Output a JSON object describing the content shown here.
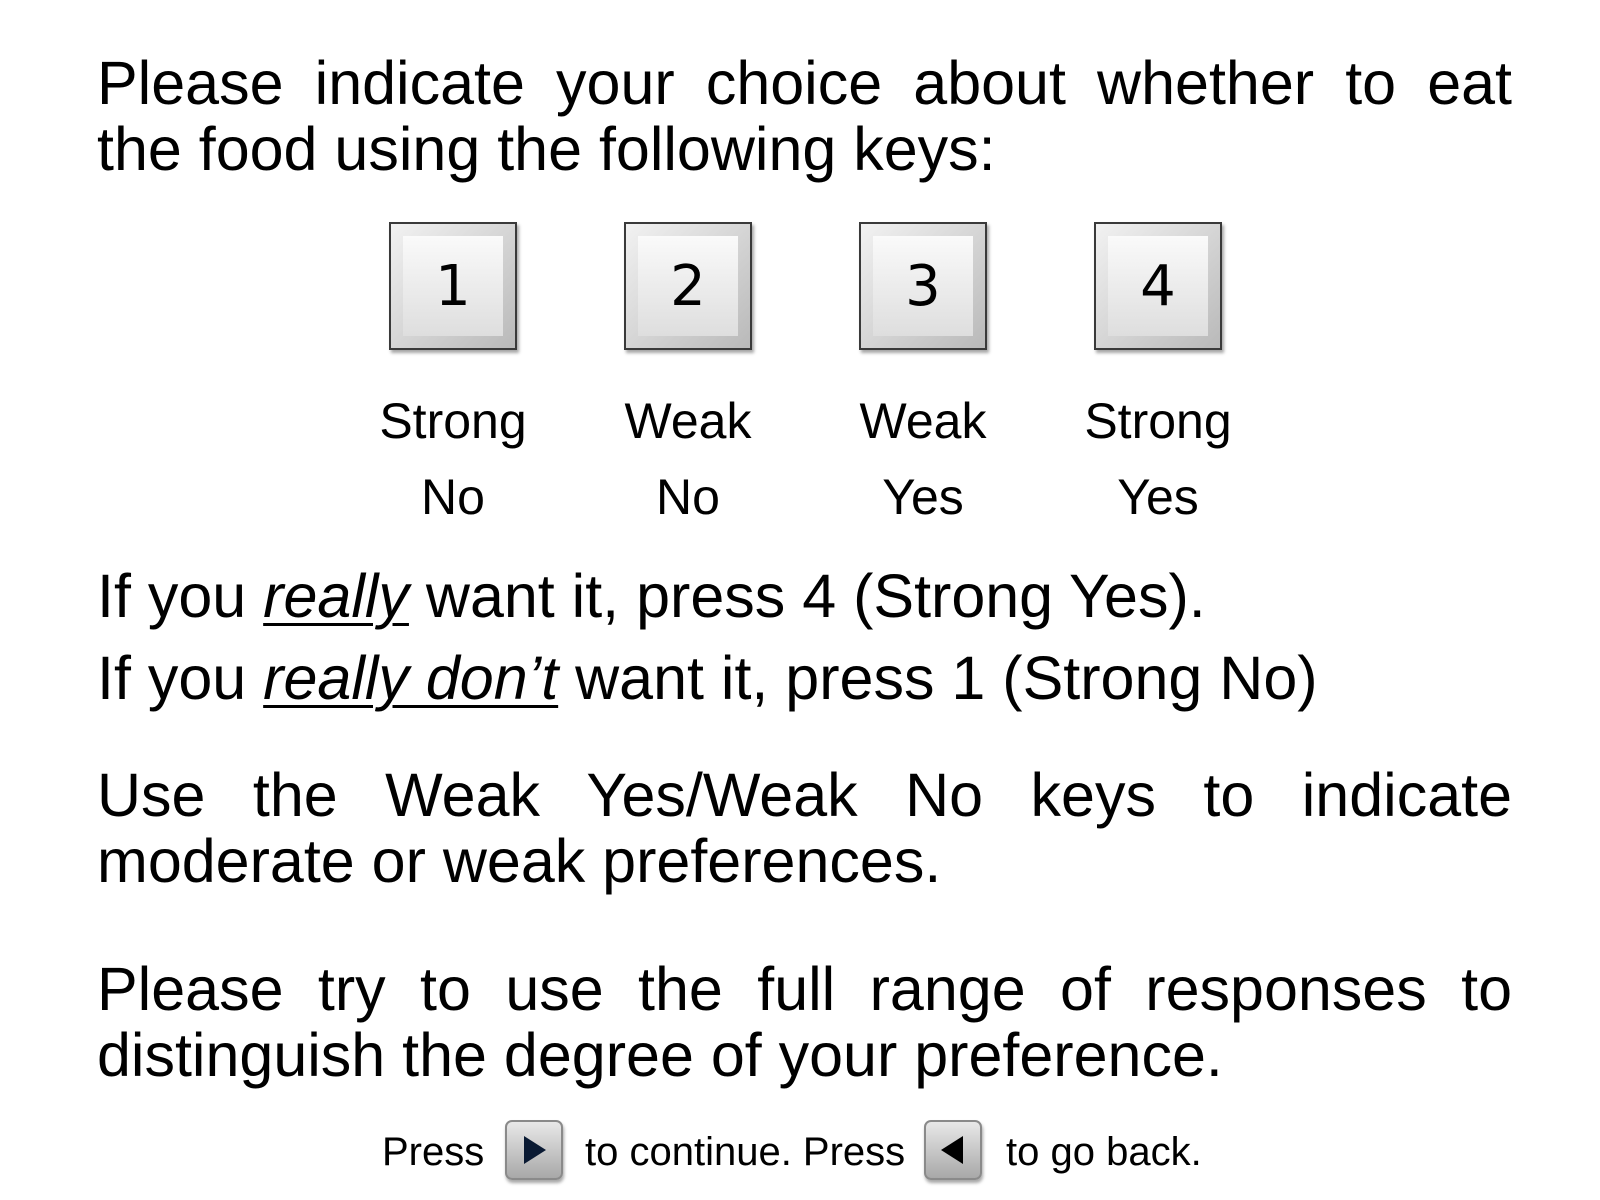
{
  "instructions": {
    "intro": "Please indicate your choice about whether to eat the food using the following keys:",
    "strong_yes_line": {
      "prefix": "If you ",
      "emphasis": "really",
      "suffix": " want it, press 4 (Strong Yes)."
    },
    "strong_no_line": {
      "prefix": "If you ",
      "emphasis": "really don’t",
      "suffix": " want it, press 1 (Strong No)"
    },
    "weak_note": "Use the Weak Yes/Weak No keys to indicate moderate or weak preferences.",
    "range_note": "Please try to use the full range of responses to distinguish the degree of your preference."
  },
  "keys": [
    {
      "key": "1",
      "label_top": "Strong",
      "label_bottom": "No"
    },
    {
      "key": "2",
      "label_top": "Weak",
      "label_bottom": "No"
    },
    {
      "key": "3",
      "label_top": "Weak",
      "label_bottom": "Yes"
    },
    {
      "key": "4",
      "label_top": "Strong",
      "label_bottom": "Yes"
    }
  ],
  "footer": {
    "press_label": "Press",
    "continue_label": "to continue. Press",
    "back_label": "to go back.",
    "next_icon": "play-right-icon",
    "back_icon": "play-left-icon"
  }
}
